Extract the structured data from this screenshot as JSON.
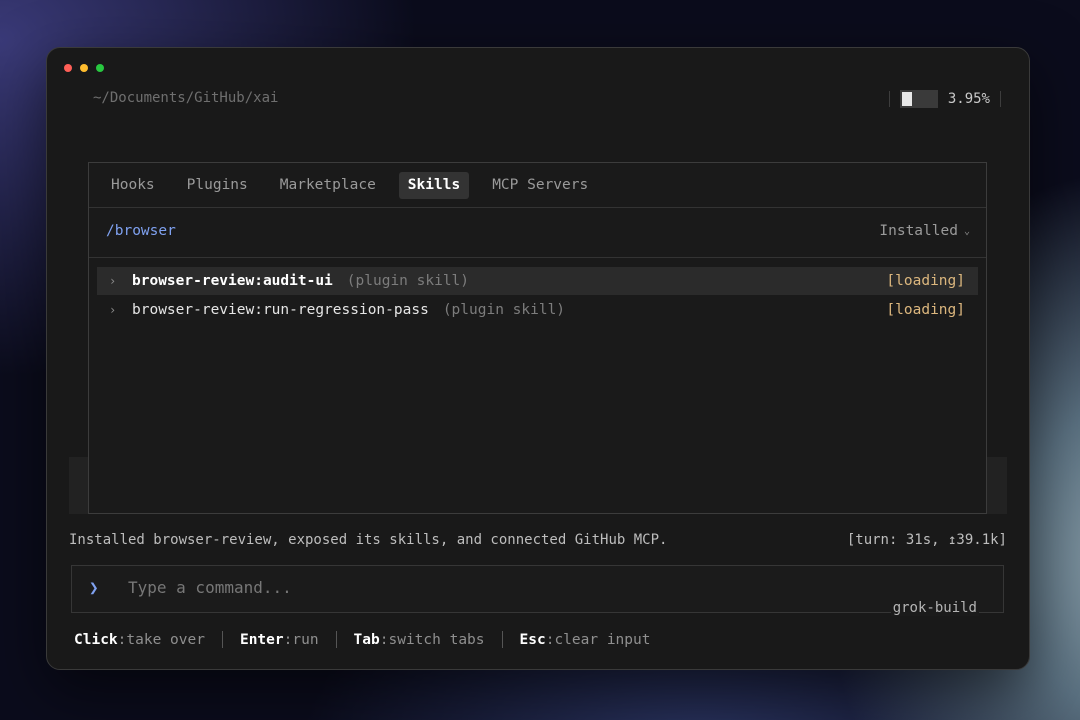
{
  "window": {
    "cwd": "~/Documents/GitHub/xai"
  },
  "context": {
    "usage_label": "3.95%",
    "usage_fraction": 0.0395
  },
  "tabs": [
    {
      "label": "Hooks"
    },
    {
      "label": "Plugins"
    },
    {
      "label": "Marketplace"
    },
    {
      "label": "Skills",
      "active": true
    },
    {
      "label": "MCP Servers"
    }
  ],
  "filter": {
    "query": "/browser",
    "dropdown_value": "Installed"
  },
  "skills": [
    {
      "name": "browser-review:audit-ui",
      "kind": "(plugin skill)",
      "status": "[loading]",
      "selected": true
    },
    {
      "name": "browser-review:run-regression-pass",
      "kind": "(plugin skill)",
      "status": "[loading]",
      "selected": false
    }
  ],
  "status_message": "Installed browser-review, exposed its skills, and connected GitHub MCP.",
  "turn_info": "[turn: 31s, ↥39.1k]",
  "command_input": {
    "prompt_symbol": "❯",
    "placeholder": "Type a command...",
    "value": ""
  },
  "model_label": "grok-build",
  "shortcuts": [
    {
      "key": "Click",
      "action": ":take over"
    },
    {
      "key": "Enter",
      "action": ":run"
    },
    {
      "key": "Tab",
      "action": ":switch tabs"
    },
    {
      "key": "Esc",
      "action": ":clear input"
    }
  ],
  "colors": {
    "accent_blue": "#7fa1f0",
    "loading_status": "#dcb77e",
    "window_bg": "#191919",
    "traffic_red": "#ff5f57",
    "traffic_yellow": "#febc2e",
    "traffic_green": "#28c840"
  }
}
